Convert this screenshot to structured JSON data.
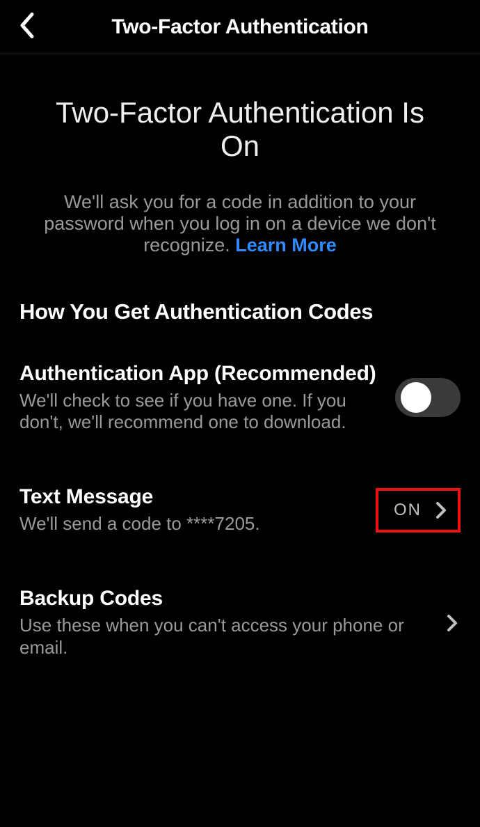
{
  "header": {
    "title": "Two-Factor Authentication"
  },
  "intro": {
    "title": "Two-Factor Authentication Is On",
    "description": "We'll ask you for a code in addition to your password when you log in on a device we don't recognize. ",
    "learn_more": "Learn More"
  },
  "section": {
    "heading": "How You Get Authentication Codes"
  },
  "rows": {
    "app": {
      "title": "Authentication App (Recommended)",
      "sub": "We'll check to see if you have one. If you don't, we'll recommend one to download.",
      "toggle_on": false
    },
    "sms": {
      "title": "Text Message",
      "sub": "We'll send a code to ****7205.",
      "state_label": "ON"
    },
    "backup": {
      "title": "Backup Codes",
      "sub": "Use these when you can't access your phone or email."
    }
  }
}
